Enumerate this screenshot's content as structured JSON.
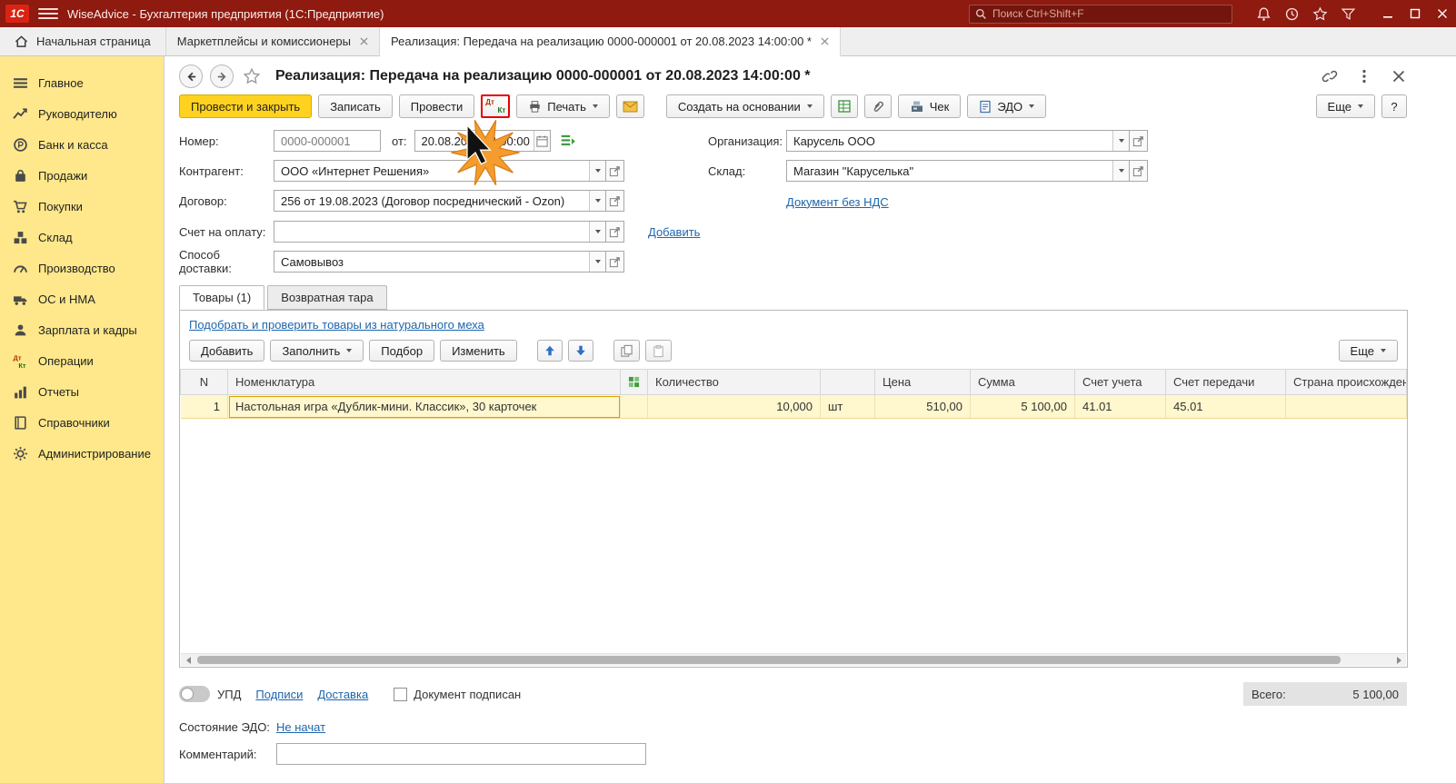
{
  "titlebar": {
    "logo": "1С",
    "title": "WiseAdvice - Бухгалтерия предприятия  (1С:Предприятие)",
    "search_placeholder": "Поиск Ctrl+Shift+F"
  },
  "tabbar": {
    "home_label": "Начальная страница",
    "tabs": [
      {
        "label": "Маркетплейсы и комиссионеры"
      },
      {
        "label": "Реализация: Передача на реализацию 0000-000001 от 20.08.2023 14:00:00 *"
      }
    ]
  },
  "sidebar": {
    "items": [
      {
        "label": "Главное"
      },
      {
        "label": "Руководителю"
      },
      {
        "label": "Банк и касса"
      },
      {
        "label": "Продажи"
      },
      {
        "label": "Покупки"
      },
      {
        "label": "Склад"
      },
      {
        "label": "Производство"
      },
      {
        "label": "ОС и НМА"
      },
      {
        "label": "Зарплата и кадры"
      },
      {
        "label": "Операции"
      },
      {
        "label": "Отчеты"
      },
      {
        "label": "Справочники"
      },
      {
        "label": "Администрирование"
      }
    ]
  },
  "doc": {
    "title": "Реализация: Передача на реализацию 0000-000001 от 20.08.2023 14:00:00 *",
    "toolbar": {
      "post_and_close": "Провести и закрыть",
      "write": "Записать",
      "post": "Провести",
      "dt": "Дт",
      "kt": "Кт",
      "print": "Печать",
      "create_on_base": "Создать на основании",
      "receipt": "Чек",
      "edo": "ЭДО",
      "more": "Еще",
      "help": "?"
    },
    "fields": {
      "number_label": "Номер:",
      "number_value": "0000-000001",
      "date_label": "от:",
      "date_value": "20.08.2023 14:00:00",
      "counterparty_label": "Контрагент:",
      "counterparty_value": "ООО «Интернет Решения»",
      "contract_label": "Договор:",
      "contract_value": "256 от 19.08.2023 (Договор посреднический - Ozon)",
      "invoice_label": "Счет на оплату:",
      "invoice_value": "",
      "add_link": "Добавить",
      "delivery_label": "Способ доставки:",
      "delivery_value": "Самовывоз",
      "organization_label": "Организация:",
      "organization_value": "Карусель ООО",
      "warehouse_label": "Склад:",
      "warehouse_value": "Магазин \"Каруселька\"",
      "no_vat_link": "Документ без НДС"
    },
    "item_tabs": {
      "goods": "Товары (1)",
      "tare": "Возвратная тара"
    },
    "fur_link": "Подобрать и проверить товары из натурального меха",
    "grid_toolbar": {
      "add": "Добавить",
      "fill": "Заполнить",
      "pick": "Подбор",
      "edit": "Изменить",
      "more": "Еще"
    },
    "grid": {
      "headers": {
        "n": "N",
        "nomenclature": "Номенклатура",
        "qty": "Количество",
        "price": "Цена",
        "sum": "Сумма",
        "account": "Счет учета",
        "transfer": "Счет передачи",
        "country": "Страна происхождения"
      },
      "rows": [
        {
          "n": "1",
          "nomenclature": "Настольная игра «Дублик-мини. Классик», 30 карточек",
          "qty": "10,000",
          "unit": "шт",
          "price": "510,00",
          "sum": "5 100,00",
          "account": "41.01",
          "transfer": "45.01",
          "country": ""
        }
      ]
    },
    "footer": {
      "upd": "УПД",
      "signs_link": "Подписи",
      "delivery_link": "Доставка",
      "signed_checkbox": "Документ подписан",
      "total_label": "Всего:",
      "total_value": "5 100,00",
      "edo_label": "Состояние ЭДО:",
      "edo_link": "Не начат",
      "comment_label": "Комментарий:"
    }
  }
}
